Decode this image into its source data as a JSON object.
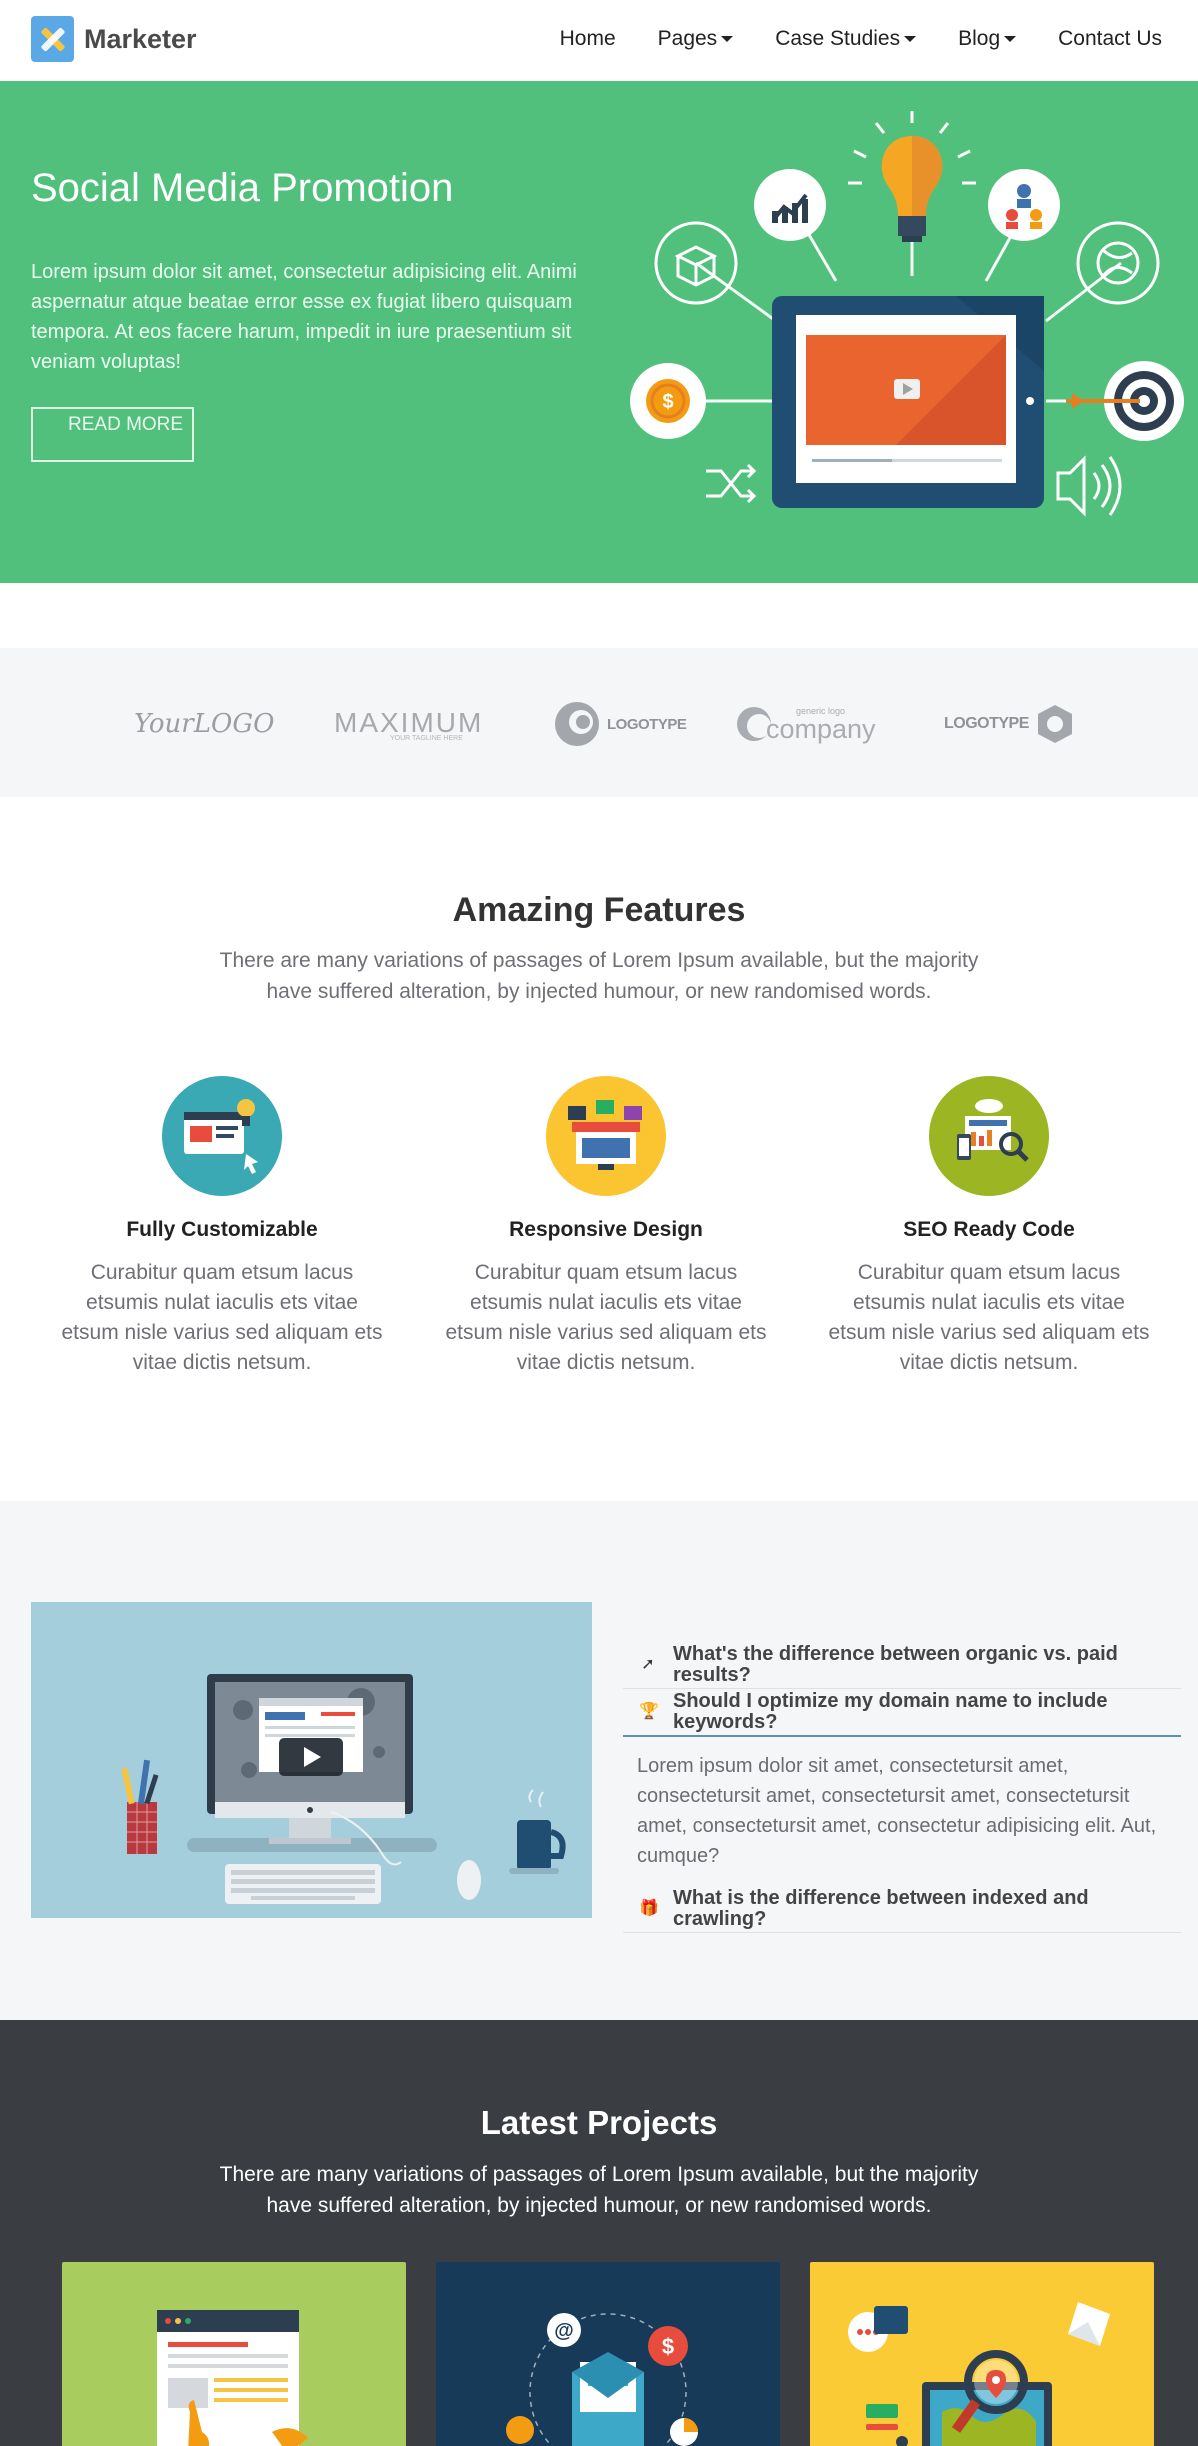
{
  "brand": {
    "name": "Marketer"
  },
  "nav": {
    "home": "Home",
    "pages": "Pages",
    "case_studies": "Case Studies",
    "blog": "Blog",
    "contact": "Contact Us"
  },
  "hero": {
    "title": "Social Media Promotion",
    "text": "Lorem ipsum dolor sit amet, consectetur adipisicing elit. Animi aspernatur atque beatae error esse ex fugiat libero quisquam tempora. At eos facere harum, impedit in iure praesentium sit veniam voluptas!",
    "button": "READ MORE",
    "colors": {
      "background": "#50c07c"
    }
  },
  "logos": {
    "yourlogo": "YourLOGO",
    "maximum": "MAXIMUM",
    "maximum_tag": "YOUR TAGLINE HERE",
    "logotype1": "LOGOTYPE",
    "company_small": "generic logo",
    "company": "company",
    "logotype2": "LOGOTYPE"
  },
  "features": {
    "title": "Amazing Features",
    "subtitle": "There are many variations of passages of Lorem Ipsum available, but the majority have suffered alteration, by injected humour, or new randomised words.",
    "items": [
      {
        "title": "Fully Customizable",
        "text": "Curabitur quam etsum lacus etsumis nulat iaculis ets vitae etsum nisle varius sed aliquam ets vitae dictis netsum.",
        "icon": "customize-icon",
        "color": "#3aa9b4"
      },
      {
        "title": "Responsive Design",
        "text": "Curabitur quam etsum lacus etsumis nulat iaculis ets vitae etsum nisle varius sed aliquam ets vitae dictis netsum.",
        "icon": "responsive-icon",
        "color": "#fbc531"
      },
      {
        "title": "SEO Ready Code",
        "text": "Curabitur quam etsum lacus etsumis nulat iaculis ets vitae etsum nisle varius sed aliquam ets vitae dictis netsum.",
        "icon": "seo-icon",
        "color": "#9cb523"
      }
    ]
  },
  "faq": {
    "items": [
      {
        "question": "What's the difference between organic vs. paid results?",
        "icon": "rocket-icon"
      },
      {
        "question": "Should I optimize my domain name to include keywords?",
        "icon": "trophy-icon",
        "answer": "Lorem ipsum dolor sit amet, consectetursit amet, consectetursit amet, consectetursit amet, consectetursit amet, consectetursit amet, consectetur adipisicing elit. Aut, cumque?"
      },
      {
        "question": "What is the difference between indexed and crawling?",
        "icon": "gift-icon"
      }
    ]
  },
  "projects": {
    "title": "Latest Projects",
    "subtitle": "There are many variations of passages of Lorem Ipsum available, but the majority have suffered alteration, by injected humour, or new randomised words.",
    "cards": [
      {
        "icon": "web-page-icon",
        "color": "#a8cd5e"
      },
      {
        "icon": "email-marketing-icon",
        "color": "#163a58"
      },
      {
        "icon": "global-search-icon",
        "color": "#fbcb35"
      }
    ]
  }
}
